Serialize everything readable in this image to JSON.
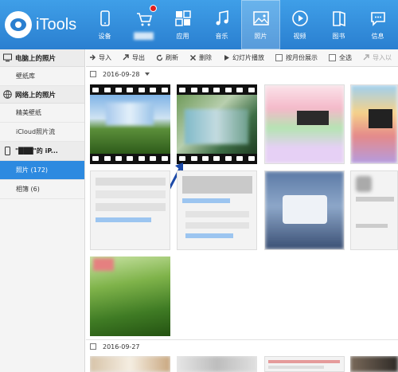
{
  "app": {
    "name": "iTools"
  },
  "nav": [
    {
      "label": "设备",
      "icon": "device-icon"
    },
    {
      "label": "████",
      "icon": "store-icon",
      "badge": true,
      "blurred": true
    },
    {
      "label": "应用",
      "icon": "apps-icon"
    },
    {
      "label": "音乐",
      "icon": "music-icon"
    },
    {
      "label": "照片",
      "icon": "photo-icon",
      "active": true
    },
    {
      "label": "视频",
      "icon": "video-icon"
    },
    {
      "label": "图书",
      "icon": "book-icon"
    },
    {
      "label": "信息",
      "icon": "message-icon"
    }
  ],
  "sidebar": {
    "computer_section": "电脑上的照片",
    "wallpaper_library": "壁纸库",
    "web_section": "网络上的照片",
    "fine_wallpaper": "精美壁纸",
    "icloud_stream": "iCloud照片流",
    "device_name": "\"███\"的 iP...",
    "photos": "照片 (172)",
    "albums": "相簿 (6)"
  },
  "toolbar": {
    "import": "导入",
    "export": "导出",
    "refresh": "刷新",
    "delete": "删除",
    "slideshow": "幻灯片播放",
    "by_month": "按月份展示",
    "select_all": "全选",
    "import_to": "导入以"
  },
  "groups": [
    {
      "date": "2016-09-28"
    },
    {
      "date": "2016-09-27"
    }
  ],
  "colors": {
    "accent": "#2d8ae0",
    "topbar": "#2a7fd0",
    "badge": "#e02020"
  }
}
